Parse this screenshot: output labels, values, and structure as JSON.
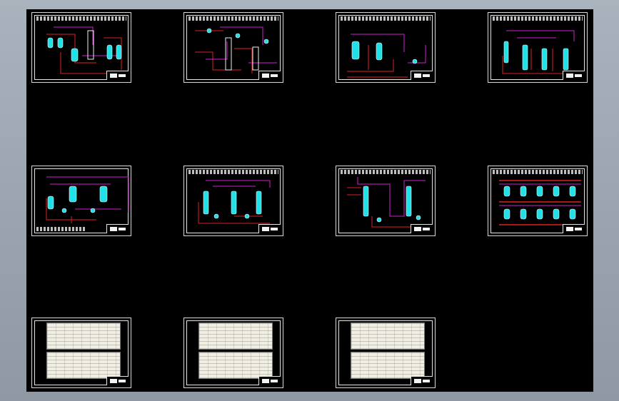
{
  "viewport": {
    "background": "#000000",
    "window_gradient": [
      "#aab2bd",
      "#8f98a3"
    ]
  },
  "sheet_count": 11,
  "sheets": [
    {
      "kind": "flow-diagram",
      "row": 1,
      "col": 1
    },
    {
      "kind": "flow-diagram",
      "row": 1,
      "col": 2
    },
    {
      "kind": "flow-diagram",
      "row": 1,
      "col": 3
    },
    {
      "kind": "flow-diagram",
      "row": 1,
      "col": 4
    },
    {
      "kind": "flow-diagram",
      "row": 2,
      "col": 1
    },
    {
      "kind": "flow-diagram",
      "row": 2,
      "col": 2
    },
    {
      "kind": "flow-diagram",
      "row": 2,
      "col": 3
    },
    {
      "kind": "flow-diagram",
      "row": 2,
      "col": 4
    },
    {
      "kind": "equipment-table",
      "row": 3,
      "col": 1
    },
    {
      "kind": "equipment-table",
      "row": 3,
      "col": 2
    },
    {
      "kind": "equipment-table",
      "row": 3,
      "col": 3
    }
  ],
  "colors": {
    "red_pipe": "#e02020",
    "magenta_pipe": "#d020d0",
    "cyan_vessel": "#20e0e8",
    "white_line": "#f0f0f0",
    "table_paper": "#f1efe3"
  }
}
